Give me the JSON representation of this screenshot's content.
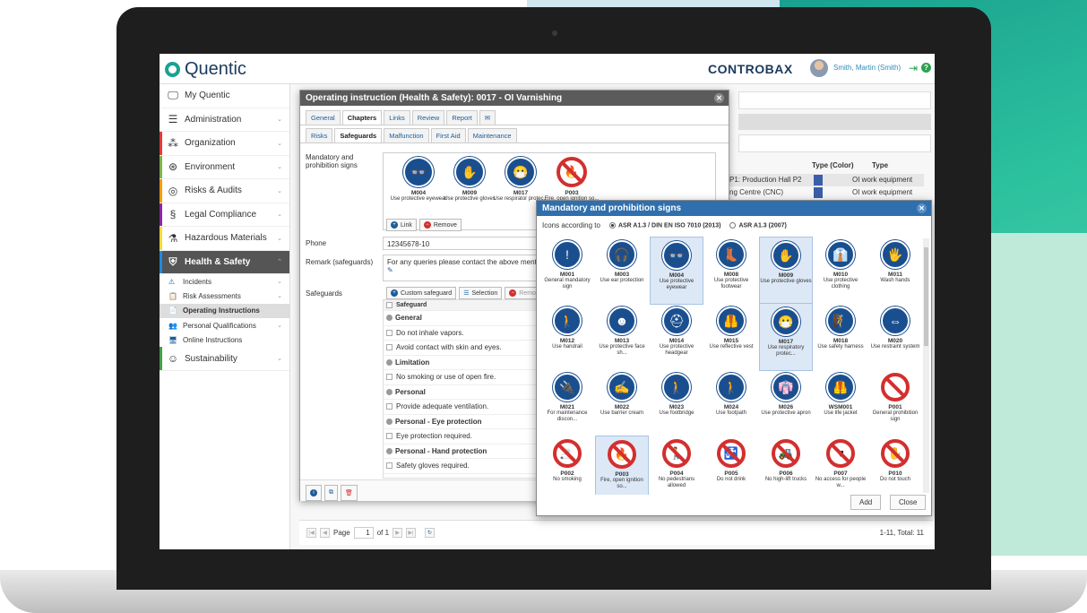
{
  "app": {
    "logo_text": "Quentic",
    "brand": "CONTROBAX",
    "user": "Smith, Martin (Smith)"
  },
  "sidebar": {
    "items": [
      {
        "label": "My Quentic",
        "icon": "monitor-icon",
        "color": "#ffffff"
      },
      {
        "label": "Administration",
        "icon": "menu-icon",
        "color": "#ffffff"
      },
      {
        "label": "Organization",
        "icon": "org-icon",
        "color": "#e53935"
      },
      {
        "label": "Environment",
        "icon": "globe-icon",
        "color": "#7cb342"
      },
      {
        "label": "Risks & Audits",
        "icon": "target-icon",
        "color": "#ff9800"
      },
      {
        "label": "Legal Compliance",
        "icon": "paragraph-icon",
        "color": "#8e24aa"
      },
      {
        "label": "Hazardous Materials",
        "icon": "flask-icon",
        "color": "#fdd835"
      },
      {
        "label": "Health & Safety",
        "icon": "shield-icon",
        "color": "#1e88e5"
      }
    ],
    "subitems": [
      "Incidents",
      "Risk Assessments",
      "Operating Instructions",
      "Personal Qualifications",
      "Online Instructions"
    ],
    "last_item": {
      "label": "Sustainability",
      "color": "#43a047"
    }
  },
  "dialog": {
    "title": "Operating instruction (Health & Safety): 0017 - OI Varnishing",
    "tabs": [
      "General",
      "Chapters",
      "Links",
      "Review",
      "Report"
    ],
    "subtabs": [
      "Risks",
      "Safeguards",
      "Malfunction",
      "First Aid",
      "Maintenance"
    ],
    "signs_label": "Mandatory and prohibition signs",
    "signs": [
      {
        "code": "M004",
        "desc": "Use protective eyewear"
      },
      {
        "code": "M009",
        "desc": "Use protective gloves"
      },
      {
        "code": "M017",
        "desc": "Use respirator protec..."
      },
      {
        "code": "P003",
        "desc": "Fire, open ignition so..."
      }
    ],
    "link_btn": "Link",
    "remove_btn": "Remove",
    "phone_label": "Phone",
    "phone_value": "12345678-10",
    "remark_label": "Remark (safeguards)",
    "remark_value": "For any queries please contact the above mentioned",
    "safeguards_label": "Safeguards",
    "custom_btn": "Custom safeguard",
    "selection_btn": "Selection",
    "remove2_btn": "Remove",
    "sg_header": "Safeguard",
    "sg_rows": [
      {
        "t": "General",
        "g": true
      },
      {
        "t": "Do not inhale vapors.",
        "g": false
      },
      {
        "t": "Avoid contact with skin and eyes.",
        "g": false
      },
      {
        "t": "Limitation",
        "g": true
      },
      {
        "t": "No smoking or use of open fire.",
        "g": false
      },
      {
        "t": "Personal",
        "g": true
      },
      {
        "t": "Provide adequate ventilation.",
        "g": false
      },
      {
        "t": "Personal - Eye protection",
        "g": true
      },
      {
        "t": "Eye protection required.",
        "g": false
      },
      {
        "t": "Personal - Hand protection",
        "g": true
      },
      {
        "t": "Safety gloves required.",
        "g": false
      }
    ]
  },
  "table": {
    "header_color": "Type (Color)",
    "header_type": "Type",
    "rows": [
      {
        "loc": "P1: Production Hall P2",
        "type": "OI work equipment"
      },
      {
        "loc": "ng Centre (CNC)",
        "type": "OI work equipment"
      }
    ]
  },
  "picker": {
    "title": "Mandatory and prohibition signs",
    "according": "Icons according to",
    "opt1": "ASR A1.3 / DIN EN ISO 7010 (2013)",
    "opt2": "ASR A1.3 (2007)",
    "signs": [
      {
        "code": "M001",
        "desc": "General mandatory sign",
        "type": "blue",
        "glyph": "!",
        "sel": false
      },
      {
        "code": "M003",
        "desc": "Use ear protection",
        "type": "blue",
        "glyph": "🎧",
        "sel": false
      },
      {
        "code": "M004",
        "desc": "Use protective eyewear",
        "type": "blue",
        "glyph": "👓",
        "sel": true
      },
      {
        "code": "M008",
        "desc": "Use protective footwear",
        "type": "blue",
        "glyph": "👢",
        "sel": false
      },
      {
        "code": "M009",
        "desc": "Use protective gloves",
        "type": "blue",
        "glyph": "✋",
        "sel": true
      },
      {
        "code": "M010",
        "desc": "Use protective clothing",
        "type": "blue",
        "glyph": "👔",
        "sel": false
      },
      {
        "code": "M011",
        "desc": "Wash hands",
        "type": "blue",
        "glyph": "🖐",
        "sel": false
      },
      {
        "code": "M012",
        "desc": "Use handrail",
        "type": "blue",
        "glyph": "🚶",
        "sel": false
      },
      {
        "code": "M013",
        "desc": "Use protective face sh...",
        "type": "blue",
        "glyph": "☻",
        "sel": false
      },
      {
        "code": "M014",
        "desc": "Use protective headgear",
        "type": "blue",
        "glyph": "⛑",
        "sel": false
      },
      {
        "code": "M015",
        "desc": "Use reflective vest",
        "type": "blue",
        "glyph": "🦺",
        "sel": false
      },
      {
        "code": "M017",
        "desc": "Use respiratory protec...",
        "type": "blue",
        "glyph": "😷",
        "sel": true
      },
      {
        "code": "M018",
        "desc": "Use safety harness",
        "type": "blue",
        "glyph": "🧗",
        "sel": false
      },
      {
        "code": "M020",
        "desc": "Use restraint system",
        "type": "blue",
        "glyph": "⇔",
        "sel": false
      },
      {
        "code": "M021",
        "desc": "For maintenance discon...",
        "type": "blue",
        "glyph": "🔌",
        "sel": false
      },
      {
        "code": "M022",
        "desc": "Use barrier cream",
        "type": "blue",
        "glyph": "✍",
        "sel": false
      },
      {
        "code": "M023",
        "desc": "Use footbridge",
        "type": "blue",
        "glyph": "🚶",
        "sel": false
      },
      {
        "code": "M024",
        "desc": "Use footpath",
        "type": "blue",
        "glyph": "🚶",
        "sel": false
      },
      {
        "code": "M026",
        "desc": "Use protective apron",
        "type": "blue",
        "glyph": "👘",
        "sel": false
      },
      {
        "code": "WSM001",
        "desc": "Use life jacket",
        "type": "blue",
        "glyph": "🦺",
        "sel": false
      },
      {
        "code": "P001",
        "desc": "General prohibition sign",
        "type": "red",
        "glyph": "",
        "sel": false
      },
      {
        "code": "P002",
        "desc": "No smoking",
        "type": "red",
        "glyph": "🚬",
        "sel": false
      },
      {
        "code": "P003",
        "desc": "Fire, open ignition so...",
        "type": "red",
        "glyph": "🔥",
        "sel": true
      },
      {
        "code": "P004",
        "desc": "No pedestrians allowed",
        "type": "red",
        "glyph": "🚶",
        "sel": false
      },
      {
        "code": "P005",
        "desc": "Do not drink",
        "type": "red",
        "glyph": "🚰",
        "sel": false
      },
      {
        "code": "P006",
        "desc": "No high-lift trucks",
        "type": "red",
        "glyph": "🚜",
        "sel": false
      },
      {
        "code": "P007",
        "desc": "No access for people w...",
        "type": "red",
        "glyph": "♥",
        "sel": false
      },
      {
        "code": "P010",
        "desc": "Do not touch",
        "type": "red",
        "glyph": "✋",
        "sel": false
      }
    ],
    "add_btn": "Add",
    "close_btn": "Close"
  },
  "pager": {
    "page_label": "Page",
    "page_value": "1",
    "of": "of 1",
    "total": "1-11, Total: 11"
  }
}
